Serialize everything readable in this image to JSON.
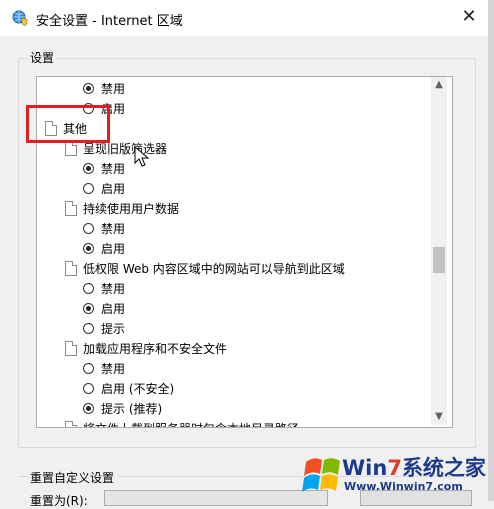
{
  "window": {
    "title": "安全设置 - Internet 区域",
    "close_glyph": "✕"
  },
  "settings": {
    "group_label": "设置",
    "rows": [
      {
        "kind": "radio",
        "indent": 2,
        "label": "禁用",
        "checked": true
      },
      {
        "kind": "radio",
        "indent": 2,
        "label": "启用",
        "checked": false
      },
      {
        "kind": "category",
        "indent": 0,
        "label": "其他"
      },
      {
        "kind": "setting",
        "indent": 1,
        "label": "呈现旧版筛选器"
      },
      {
        "kind": "radio",
        "indent": 2,
        "label": "禁用",
        "checked": true
      },
      {
        "kind": "radio",
        "indent": 2,
        "label": "启用",
        "checked": false
      },
      {
        "kind": "setting",
        "indent": 1,
        "label": "持续使用用户数据"
      },
      {
        "kind": "radio",
        "indent": 2,
        "label": "禁用",
        "checked": false
      },
      {
        "kind": "radio",
        "indent": 2,
        "label": "启用",
        "checked": true
      },
      {
        "kind": "setting",
        "indent": 1,
        "label": "低权限 Web 内容区域中的网站可以导航到此区域"
      },
      {
        "kind": "radio",
        "indent": 2,
        "label": "禁用",
        "checked": false
      },
      {
        "kind": "radio",
        "indent": 2,
        "label": "启用",
        "checked": true
      },
      {
        "kind": "radio",
        "indent": 2,
        "label": "提示",
        "checked": false
      },
      {
        "kind": "setting",
        "indent": 1,
        "label": "加载应用程序和不安全文件"
      },
      {
        "kind": "radio",
        "indent": 2,
        "label": "禁用",
        "checked": false
      },
      {
        "kind": "radio",
        "indent": 2,
        "label": "启用 (不安全)",
        "checked": false
      },
      {
        "kind": "radio",
        "indent": 2,
        "label": "提示 (推荐)",
        "checked": true
      },
      {
        "kind": "setting",
        "indent": 1,
        "label": "将文件上载到服务器时包含本地目录路径"
      }
    ],
    "scroll_up_glyph": "▲",
    "scroll_down_glyph": "▼"
  },
  "reset": {
    "group_label": "重置自定义设置",
    "reset_to_label": "重置为(R):"
  },
  "watermark": {
    "brand_prefix": "Win",
    "brand_seven": "7",
    "brand_suffix": "系统之家",
    "url": "Www.Winwin7.com"
  },
  "colors": {
    "highlight": "#e02020",
    "brand_blue": "#1c3a8a",
    "brand_red": "#e03a2a"
  }
}
